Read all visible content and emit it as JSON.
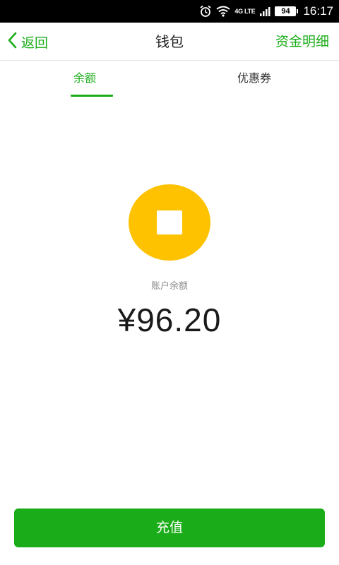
{
  "status_bar": {
    "network_label": "4G LTE",
    "battery_level": "94",
    "time": "16:17",
    "icons": [
      "alarm-icon",
      "wifi-icon",
      "signal-icon",
      "battery-icon"
    ]
  },
  "header": {
    "back_label": "返回",
    "title": "钱包",
    "detail_link": "资金明细"
  },
  "tabs": [
    {
      "label": "余额",
      "active": true
    },
    {
      "label": "优惠券",
      "active": false
    }
  ],
  "balance": {
    "label": "账户余额",
    "amount": "¥96.20",
    "coin_icon": "coin-icon"
  },
  "actions": {
    "recharge_label": "充值"
  },
  "colors": {
    "accent": "#1aad19",
    "coin": "#fec200",
    "text_primary": "#1a1a1a",
    "text_secondary": "#8c8c8c",
    "status_bar_bg": "#000000"
  }
}
